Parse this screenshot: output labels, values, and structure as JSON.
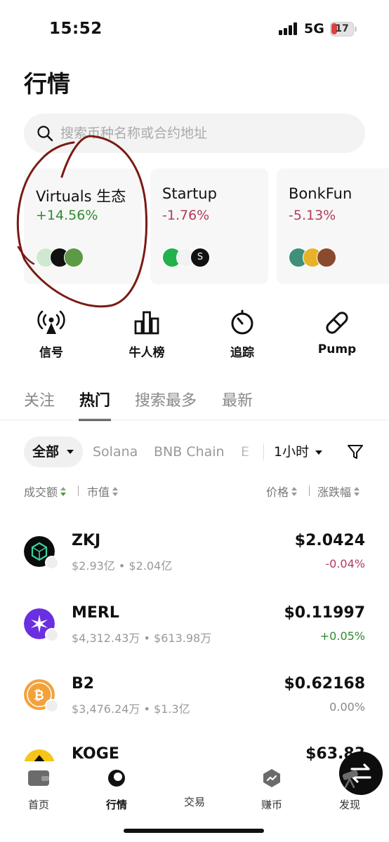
{
  "status_bar": {
    "time": "15:52",
    "network": "5G",
    "battery": "17"
  },
  "page": {
    "title": "行情"
  },
  "search": {
    "placeholder": "搜索币种名称或合约地址"
  },
  "cards": [
    {
      "name": "Virtuals 生态",
      "change": "+14.56%",
      "direction": "up"
    },
    {
      "name": "Startup",
      "change": "-1.76%",
      "direction": "down"
    },
    {
      "name": "BonkFun",
      "change": "-5.13%",
      "direction": "down"
    }
  ],
  "quick_actions": [
    {
      "label": "信号",
      "icon": "signal-broadcast-icon"
    },
    {
      "label": "牛人榜",
      "icon": "bar-chart-icon"
    },
    {
      "label": "追踪",
      "icon": "stopwatch-icon"
    },
    {
      "label": "Pump",
      "icon": "pill-icon"
    }
  ],
  "tabs": [
    "关注",
    "热门",
    "搜索最多",
    "最新"
  ],
  "active_tab": "热门",
  "filters": {
    "all_label": "全部",
    "chains": [
      "Solana",
      "BNB Chain",
      "E"
    ],
    "time_range": "1小时"
  },
  "sort_headers": {
    "volume": "成交额",
    "market_cap": "市值",
    "price": "价格",
    "change": "涨跌幅"
  },
  "tokens": [
    {
      "symbol": "ZKJ",
      "volume": "$2.93亿",
      "market_cap": "$2.04亿",
      "price": "$2.0424",
      "change": "-0.04%",
      "direction": "down"
    },
    {
      "symbol": "MERL",
      "volume": "$4,312.43万",
      "market_cap": "$613.98万",
      "price": "$0.11997",
      "change": "+0.05%",
      "direction": "up"
    },
    {
      "symbol": "B2",
      "volume": "$3,476.24万",
      "market_cap": "$1.3亿",
      "price": "$0.62168",
      "change": "0.00%",
      "direction": "flat"
    },
    {
      "symbol": "KOGE",
      "volume": "",
      "market_cap": "",
      "price": "$63.83",
      "change": "",
      "direction": "flat"
    }
  ],
  "bottom_nav": [
    {
      "label": "首页",
      "icon": "wallet-icon"
    },
    {
      "label": "行情",
      "icon": "market-icon"
    },
    {
      "label": "交易",
      "icon": "swap-icon"
    },
    {
      "label": "赚币",
      "icon": "earn-icon"
    },
    {
      "label": "发现",
      "icon": "telescope-icon"
    }
  ],
  "colors": {
    "up": "#2f8a2f",
    "down": "#b23c5a",
    "annotation": "#7a1a14"
  }
}
